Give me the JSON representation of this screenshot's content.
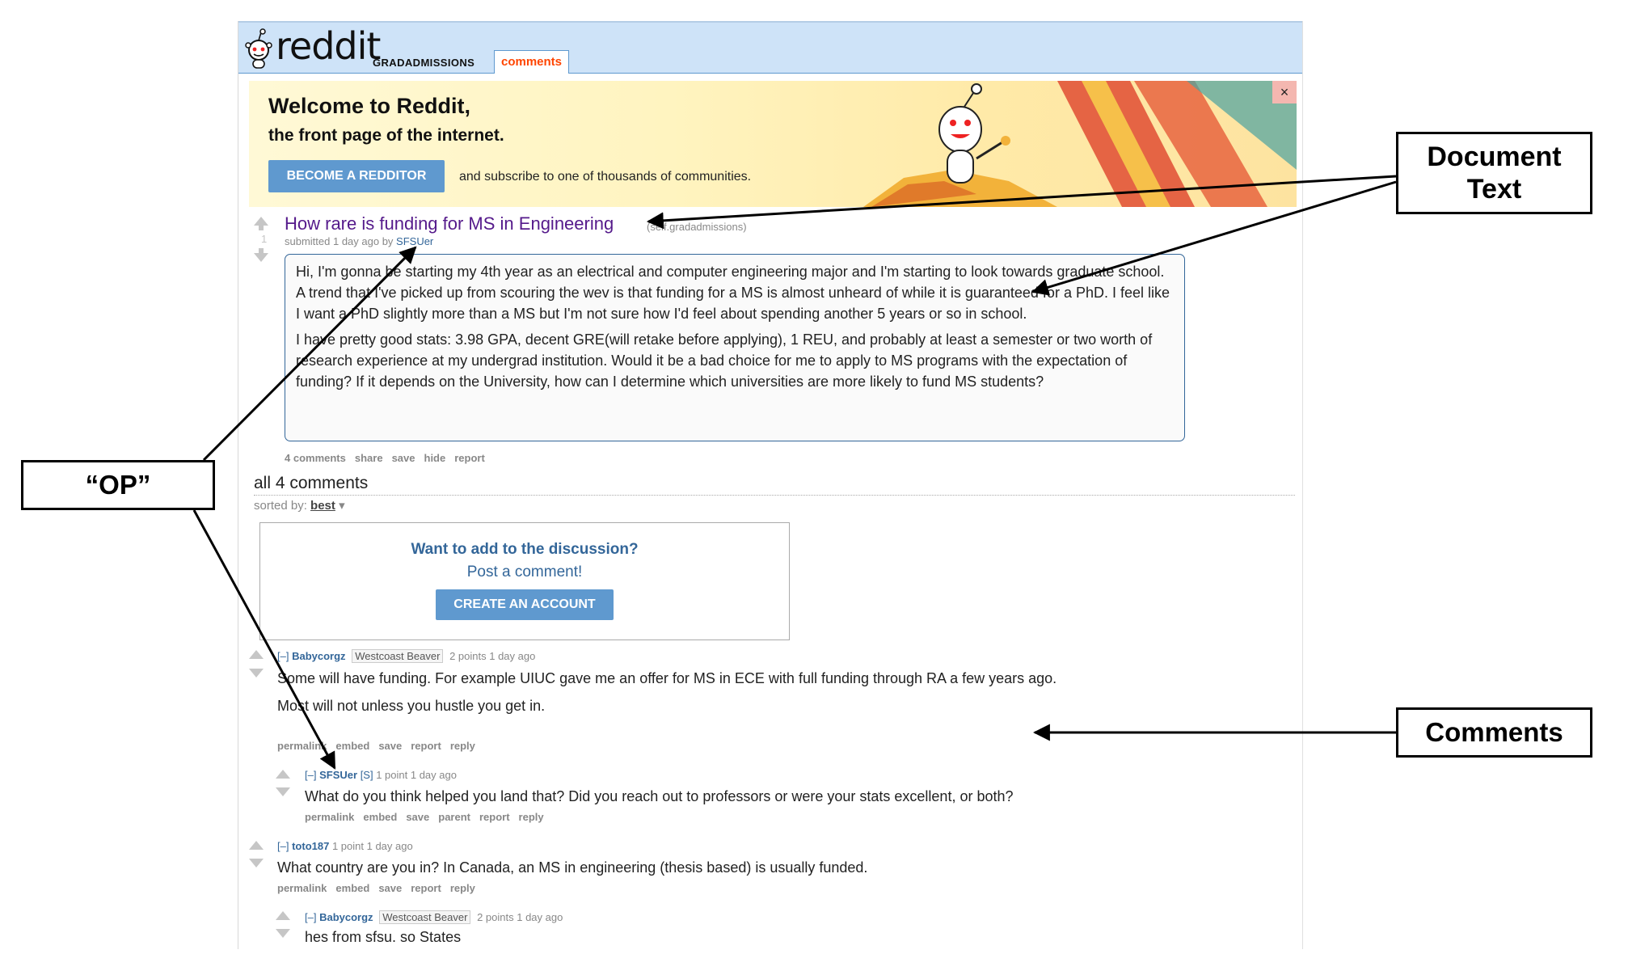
{
  "header": {
    "logo_text": "reddit",
    "subreddit_link": "GRADADMISSIONS",
    "active_tab": "comments"
  },
  "banner": {
    "headline": "Welcome to Reddit,",
    "subheadline": "the front page of the internet.",
    "cta_button": "BECOME A REDDITOR",
    "cta_text": "and subscribe to one of thousands of communities.",
    "close_label": "×"
  },
  "post": {
    "score": "1",
    "title": "How rare is funding for MS in Engineering",
    "domain": "(self.gradadmissions)",
    "submitted_prefix": "submitted 1 day ago by ",
    "author": "SFSUer",
    "body": [
      "Hi, I'm gonna be starting my 4th year as an electrical and computer engineering major and I'm starting to look towards graduate school. A trend that I've picked up from scouring the wev is that funding for a MS is almost unheard of while it is guaranteed for a PhD. I feel like I want a PhD slightly more than a MS but I'm not sure how I'd feel about spending another 5 years or so in school.",
      "I have pretty good stats: 3.98 GPA, decent GRE(will retake before applying), 1 REU, and probably at least a semester or two worth of research experience at my undergrad institution. Would it be a bad choice for me to apply to MS programs with the expectation of funding? If it depends on the University, how can I determine which universities are more likely to fund MS students?"
    ],
    "buttons": [
      "4 comments",
      "share",
      "save",
      "hide",
      "report"
    ]
  },
  "comments_area": {
    "heading": "all 4 comments",
    "sorted_by_label": "sorted by:",
    "sorted_by_value": "best",
    "prompt_question": "Want to add to the discussion?",
    "prompt_text": "Post a comment!",
    "create_account": "CREATE AN ACCOUNT"
  },
  "comments": [
    {
      "toggle": "[–]",
      "author": "Babycorgz",
      "flair": "Westcoast Beaver",
      "meta": "2 points 1 day ago",
      "body": [
        "Some will have funding. For example UIUC gave me an offer for MS in ECE with full funding through RA a few years ago.",
        "Most will not unless you hustle you get in."
      ],
      "buttons": [
        "permalink",
        "embed",
        "save",
        "report",
        "reply"
      ]
    },
    {
      "toggle": "[–]",
      "author": "SFSUer",
      "op_tag": "[S]",
      "meta": "1 point 1 day ago",
      "body": [
        "What do you think helped you land that? Did you reach out to professors or were your stats excellent, or both?"
      ],
      "buttons": [
        "permalink",
        "embed",
        "save",
        "parent",
        "report",
        "reply"
      ]
    },
    {
      "toggle": "[–]",
      "author": "toto187",
      "meta": "1 point 1 day ago",
      "body": [
        "What country are you in? In Canada, an MS in engineering (thesis based) is usually funded."
      ],
      "buttons": [
        "permalink",
        "embed",
        "save",
        "report",
        "reply"
      ]
    },
    {
      "toggle": "[–]",
      "author": "Babycorgz",
      "flair": "Westcoast Beaver",
      "meta": "2 points 1 day ago",
      "body": [
        "hes from sfsu. so States"
      ]
    }
  ],
  "annotations": {
    "document_text": "Document Text",
    "op": "“OP”",
    "comments": "Comments"
  }
}
